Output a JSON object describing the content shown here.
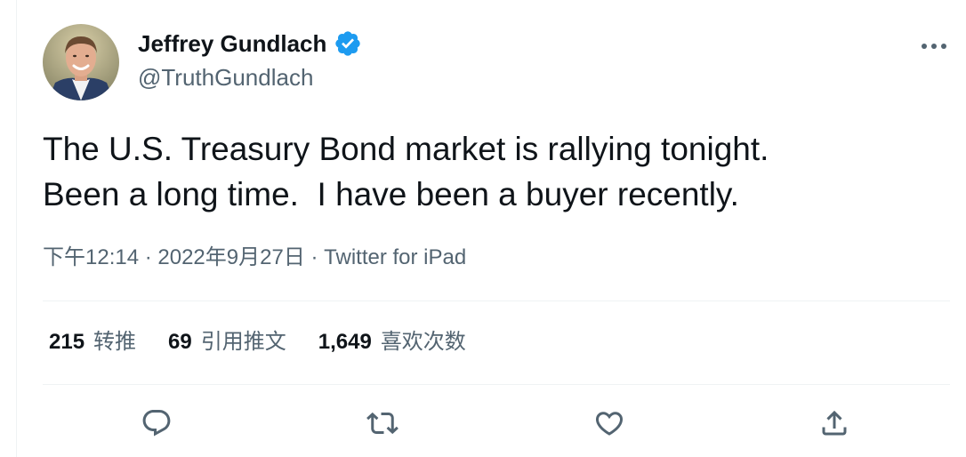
{
  "author": {
    "display_name": "Jeffrey Gundlach",
    "handle": "@TruthGundlach",
    "verified": true
  },
  "tweet": {
    "text": "The U.S. Treasury Bond market is rallying tonight.\nBeen a long time.  I have been a buyer recently.",
    "time": "下午12:14",
    "separator": " · ",
    "date": "2022年9月27日",
    "source": "Twitter for iPad"
  },
  "stats": {
    "retweets": {
      "count": "215",
      "label": "转推"
    },
    "quote_tweets": {
      "count": "69",
      "label": "引用推文"
    },
    "likes": {
      "count": "1,649",
      "label": "喜欢次数"
    }
  },
  "icons": {
    "avatar": "avatar-photo",
    "verified": "verified-badge-icon",
    "more": "more-icon",
    "reply": "reply-icon",
    "retweet": "retweet-icon",
    "like": "heart-icon",
    "share": "share-icon"
  },
  "colors": {
    "verified_blue": "#1d9bf0",
    "text_primary": "#0f1419",
    "text_secondary": "#536471",
    "divider": "#eff3f4"
  }
}
